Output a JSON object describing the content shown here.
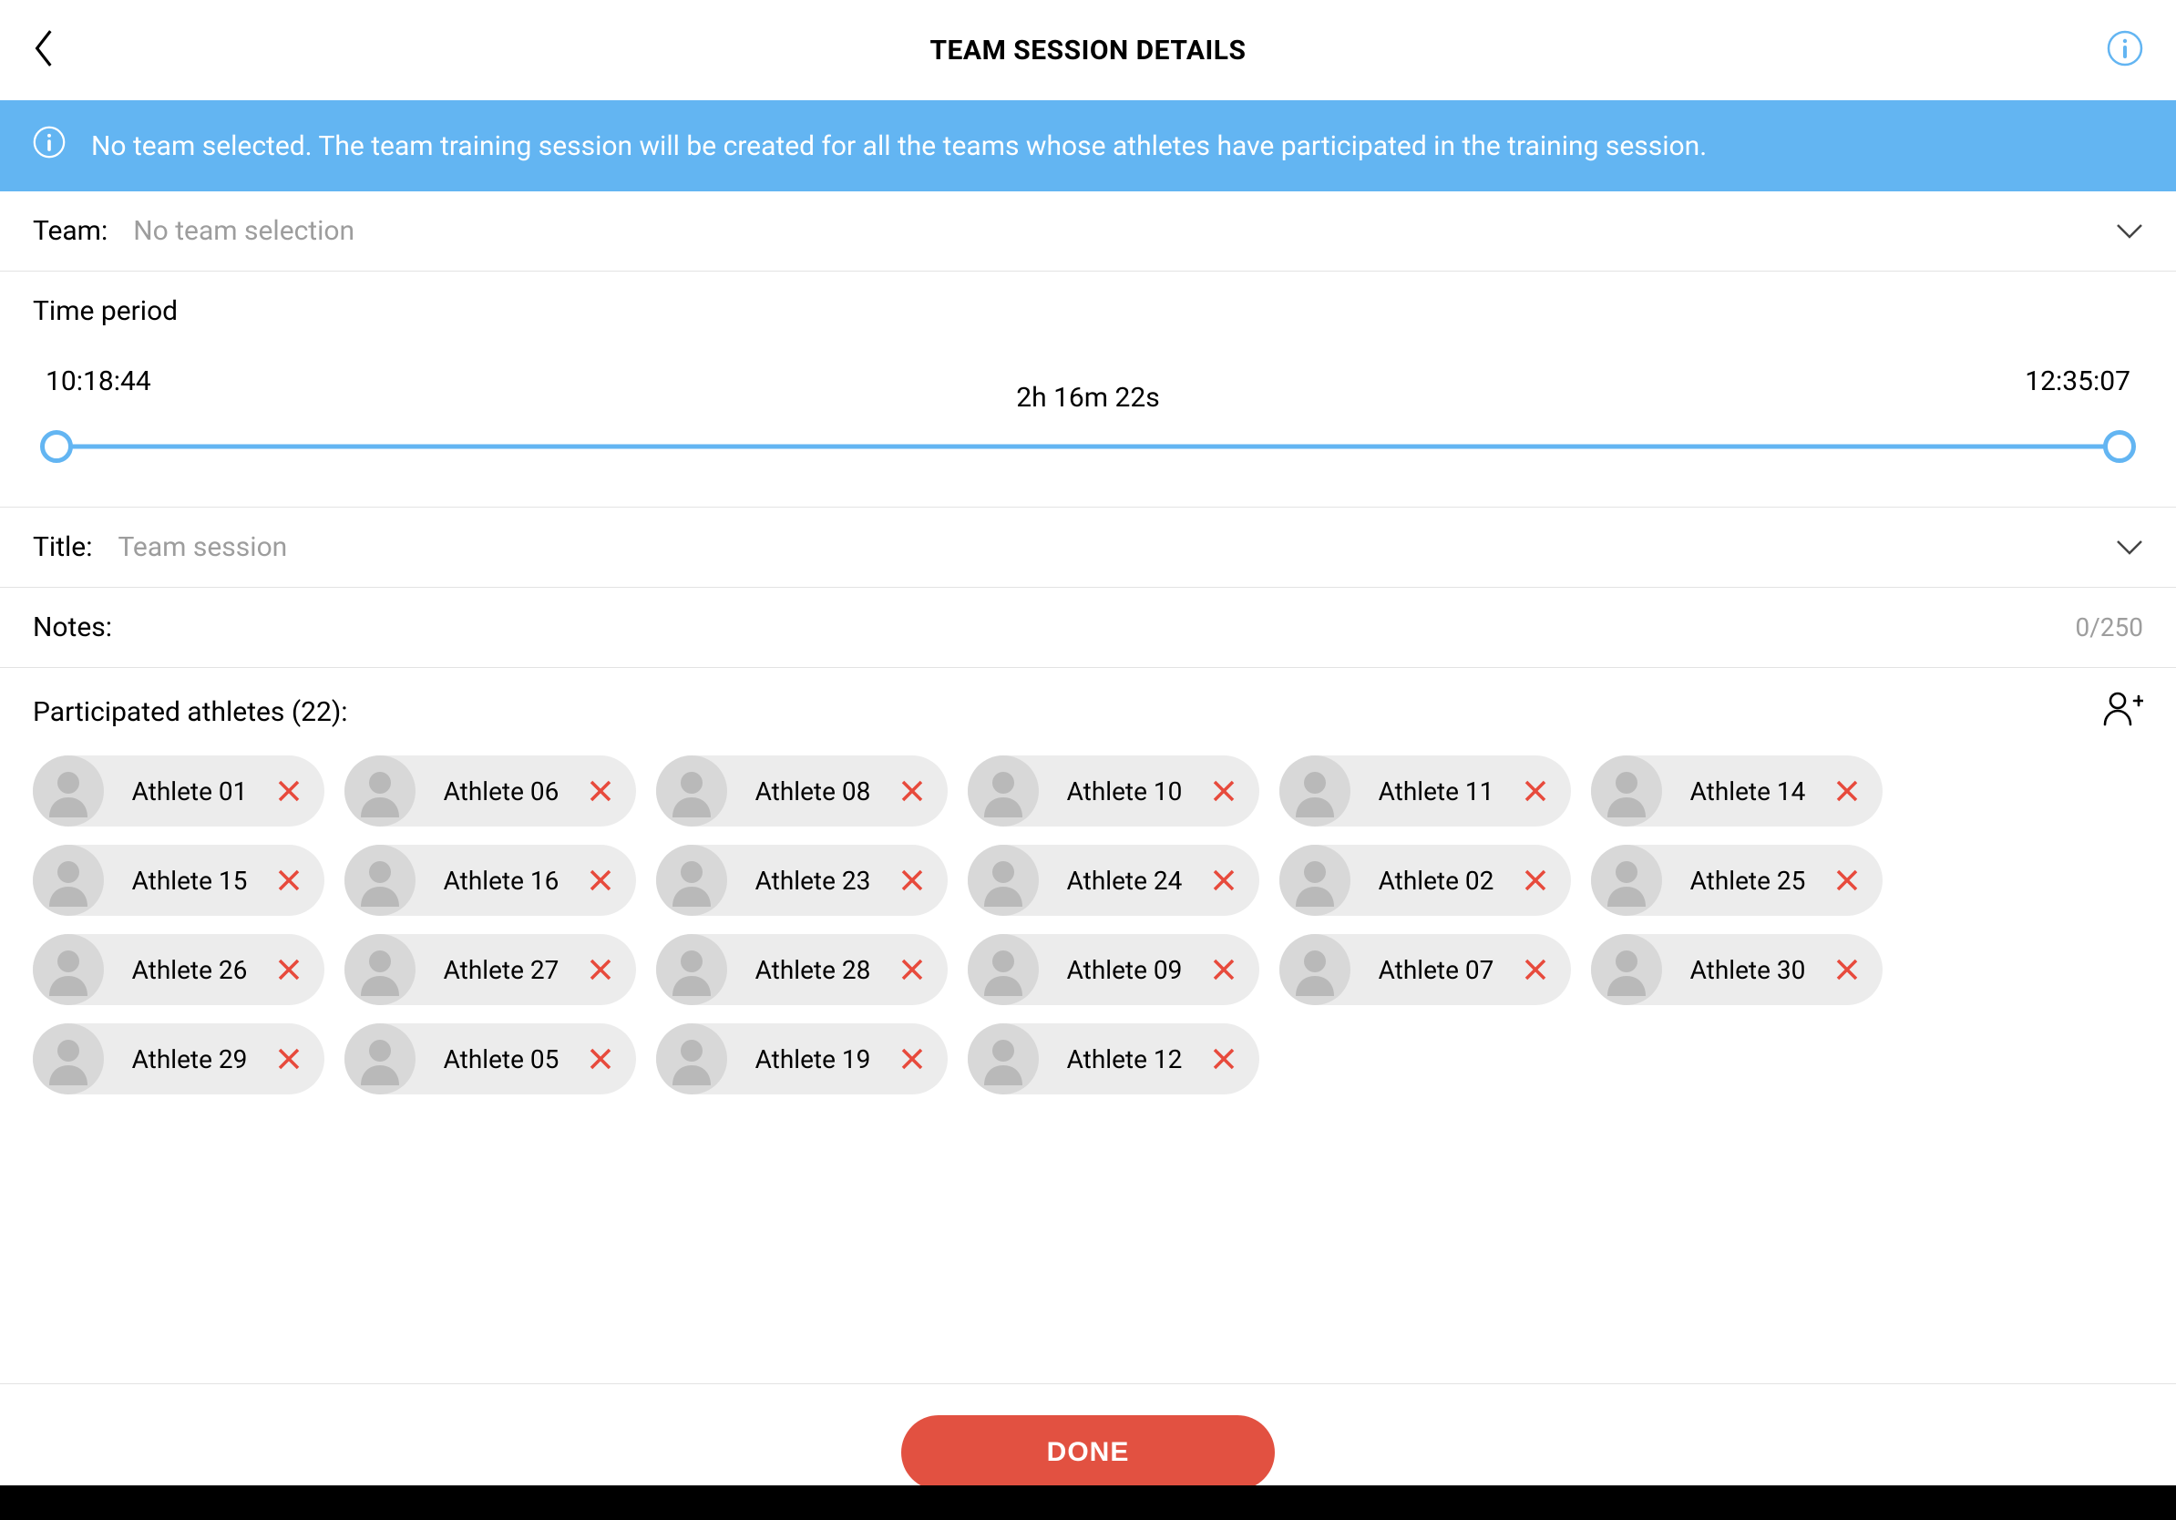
{
  "header": {
    "title": "TEAM SESSION DETAILS"
  },
  "banner": {
    "message": "No team selected. The team training session will be created for all the teams whose athletes have participated in the training session."
  },
  "team": {
    "label": "Team:",
    "placeholder": "No team selection"
  },
  "timePeriod": {
    "label": "Time period",
    "start": "10:18:44",
    "end": "12:35:07",
    "duration": "2h 16m 22s"
  },
  "title": {
    "label": "Title:",
    "placeholder": "Team session"
  },
  "notes": {
    "label": "Notes:",
    "counter": "0/250"
  },
  "athletes": {
    "heading": "Participated athletes (22):",
    "count": 22,
    "items": [
      {
        "name": "Athlete 01"
      },
      {
        "name": "Athlete 06"
      },
      {
        "name": "Athlete 08"
      },
      {
        "name": "Athlete 10"
      },
      {
        "name": "Athlete 11"
      },
      {
        "name": "Athlete 14"
      },
      {
        "name": "Athlete 15"
      },
      {
        "name": "Athlete 16"
      },
      {
        "name": "Athlete 23"
      },
      {
        "name": "Athlete 24"
      },
      {
        "name": "Athlete 02"
      },
      {
        "name": "Athlete 25"
      },
      {
        "name": "Athlete 26"
      },
      {
        "name": "Athlete 27"
      },
      {
        "name": "Athlete 28"
      },
      {
        "name": "Athlete 09"
      },
      {
        "name": "Athlete 07"
      },
      {
        "name": "Athlete 30"
      },
      {
        "name": "Athlete 29"
      },
      {
        "name": "Athlete 05"
      },
      {
        "name": "Athlete 19"
      },
      {
        "name": "Athlete 12"
      }
    ]
  },
  "footer": {
    "done": "DONE"
  },
  "colors": {
    "accent": "#63b5f2",
    "danger": "#e25141",
    "removeIcon": "#e74a3c"
  }
}
